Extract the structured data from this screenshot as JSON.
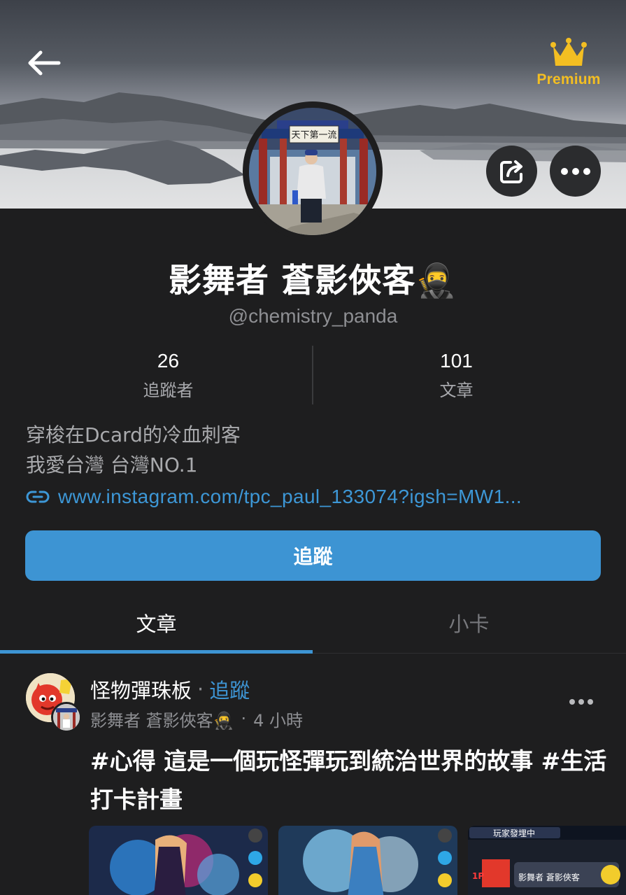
{
  "header": {
    "premium_label": "Premium",
    "back_icon": "arrow-left-icon",
    "crown_icon": "crown-icon",
    "share_icon": "share-icon",
    "more_icon": "more-horizontal-icon"
  },
  "profile": {
    "display_name": "影舞者 蒼影俠客🥷",
    "handle": "@chemistry_panda",
    "stats": [
      {
        "value": "26",
        "label": "追蹤者"
      },
      {
        "value": "101",
        "label": "文章"
      }
    ],
    "bio_lines": [
      "穿梭在Dcard的冷血刺客",
      "我愛台灣 台灣NO.1"
    ],
    "link": "www.instagram.com/tpc_paul_133074?igsh=MW1...",
    "follow_label": "追蹤",
    "avatar_sign": "天下第一流"
  },
  "tabs": [
    {
      "label": "文章",
      "active": true
    },
    {
      "label": "小卡",
      "active": false
    }
  ],
  "post": {
    "forum": "怪物彈珠板",
    "separator": "·",
    "follow_label": "追蹤",
    "author": "影舞者 蒼影俠客🥷",
    "meta_separator": "·",
    "time": "4 小時",
    "title": "#心得 這是一個玩怪彈玩到統治世界的故事 #生活打卡計畫",
    "thumb3_banner": "玩家發埋中",
    "thumb3_user": "影舞者 蒼影俠客",
    "thumb3_badge": "1P"
  },
  "colors": {
    "background": "#1e1e1f",
    "accent": "#3d94d3",
    "premium_gold": "#f3be22",
    "muted_text": "#8e8f93"
  }
}
